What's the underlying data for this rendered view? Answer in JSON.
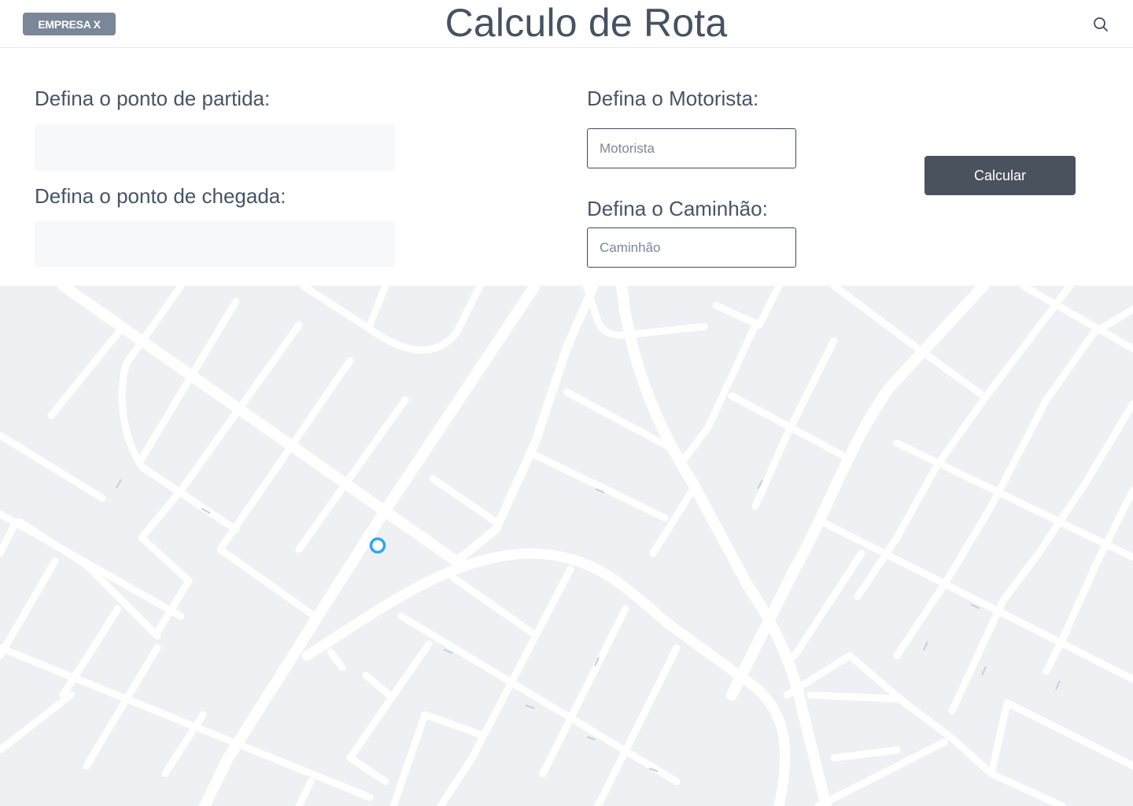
{
  "header": {
    "brand": "EMPRESA X",
    "title": "Calculo de Rota",
    "search_icon": "search-icon"
  },
  "form": {
    "start_label": "Defina o ponto de partida:",
    "start_value": "",
    "end_label": "Defina o ponto de chegada:",
    "end_value": "",
    "driver_label": "Defina o Motorista:",
    "driver_placeholder": "Motorista",
    "truck_label": "Defina o Caminhão:",
    "truck_placeholder": "Caminhão",
    "calculate_label": "Calcular"
  },
  "map": {
    "marker_icon": "location-marker-icon",
    "road_color": "#ffffff",
    "background_color": "#eef0f4",
    "marker_color": "#2aa7f5"
  }
}
